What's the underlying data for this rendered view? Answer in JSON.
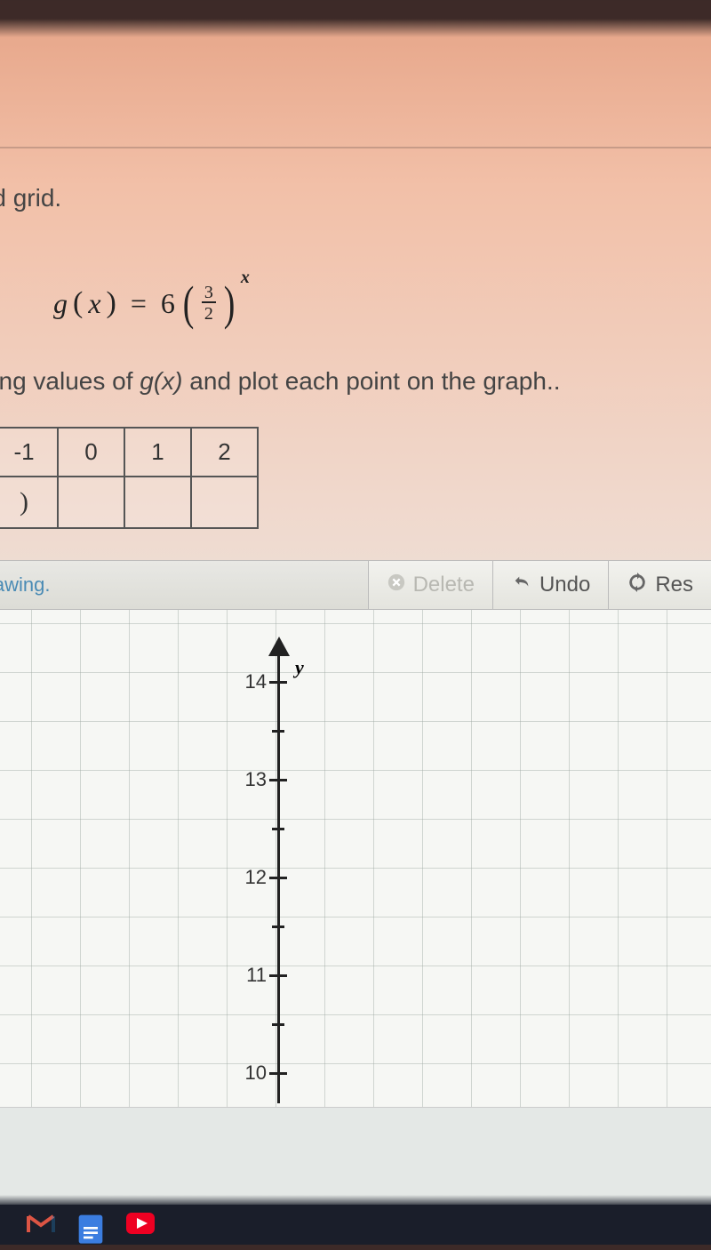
{
  "top_instruction": "vided grid.",
  "formula": {
    "func": "g",
    "var": "x",
    "coef": "6",
    "frac_num": "3",
    "frac_den": "2",
    "exp": "x"
  },
  "mid_instruction_prefix": "ponding values of ",
  "mid_instruction_gx": "g(x)",
  "mid_instruction_suffix": " and plot each point on the graph..",
  "table": {
    "row1": [
      "-1",
      "0",
      "1",
      "2"
    ],
    "row2_first": ")"
  },
  "toolbar": {
    "hint": "a drawing.",
    "delete": "Delete",
    "undo": "Undo",
    "reset": "Res"
  },
  "chart_data": {
    "type": "line",
    "title": "",
    "xlabel": "",
    "ylabel": "y",
    "ylim": [
      10,
      14
    ],
    "y_ticks": [
      14,
      13,
      12,
      11,
      10
    ],
    "series": []
  },
  "taskbar_icons": [
    "gmail-icon",
    "docs-icon",
    "youtube-icon"
  ]
}
